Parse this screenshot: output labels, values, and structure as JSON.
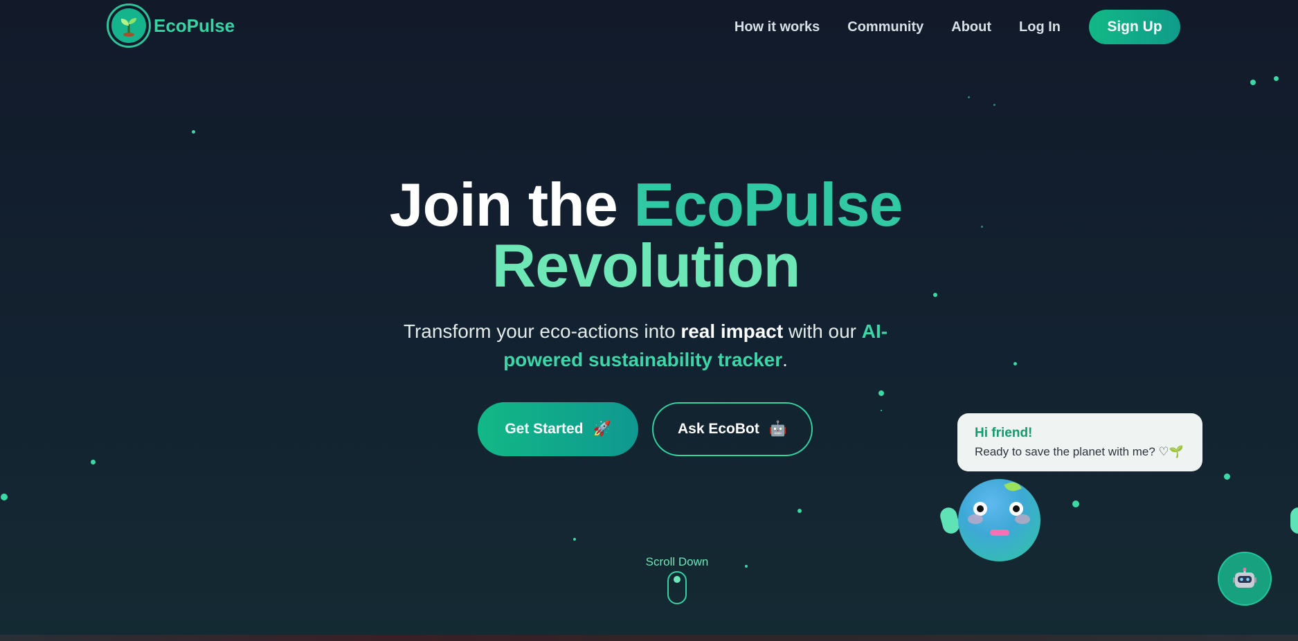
{
  "brand": {
    "name": "EcoPulse"
  },
  "nav": {
    "items": [
      "How it works",
      "Community",
      "About",
      "Log In"
    ],
    "signup_label": "Sign Up"
  },
  "hero": {
    "title_part1": "Join the",
    "title_brand": "EcoPulse",
    "title_part2": "Revolution",
    "sub_part1": "Transform your eco-actions into",
    "sub_bold": "real impact",
    "sub_part2": "with our",
    "sub_highlight": "AI-powered sustainability tracker",
    "sub_end": ".",
    "cta_primary": "Get Started",
    "cta_primary_emoji": "🚀",
    "cta_secondary": "Ask EcoBot",
    "cta_secondary_emoji": "🤖",
    "scroll_label": "Scroll Down"
  },
  "mascot": {
    "bubble_title": "Hi friend!",
    "bubble_message": "Ready to save the planet with me? ♡🌱"
  },
  "colors": {
    "accent": "#31c9a4",
    "accent_light": "#6ee7b7",
    "background": "#121a2a"
  }
}
